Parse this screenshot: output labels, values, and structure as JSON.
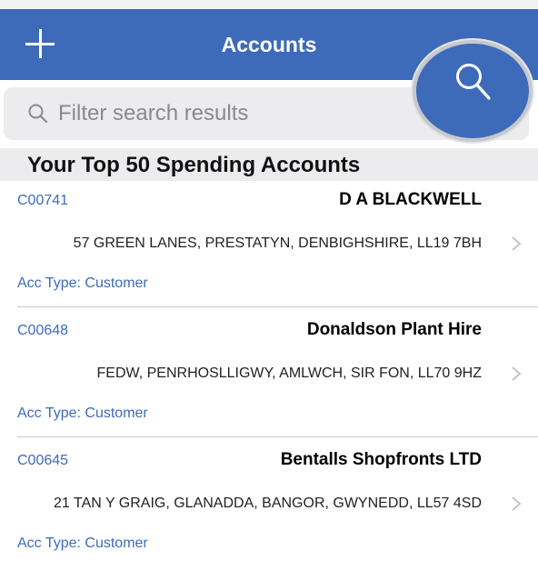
{
  "nav": {
    "title": "Accounts",
    "add_icon": "plus-icon",
    "search_icon": "magnifier-icon",
    "color": "#3d6bba"
  },
  "search": {
    "placeholder": "Filter search results"
  },
  "section": {
    "title": "Your Top 50 Spending Accounts"
  },
  "accounts": [
    {
      "code": "C00741",
      "name": "D A BLACKWELL",
      "address": "57 GREEN LANES, PRESTATYN, DENBIGHSHIRE, LL19 7BH",
      "acc_type": "Acc Type: Customer"
    },
    {
      "code": "C00648",
      "name": "Donaldson Plant Hire",
      "address": "FEDW, PENRHOSLLIGWY, AMLWCH, SIR FON, LL70 9HZ",
      "acc_type": "Acc Type: Customer"
    },
    {
      "code": "C00645",
      "name": "Bentalls Shopfronts LTD",
      "address": "21 TAN Y GRAIG, GLANADDA, BANGOR, GWYNEDD, LL57 4SD",
      "acc_type": "Acc Type: Customer"
    }
  ]
}
